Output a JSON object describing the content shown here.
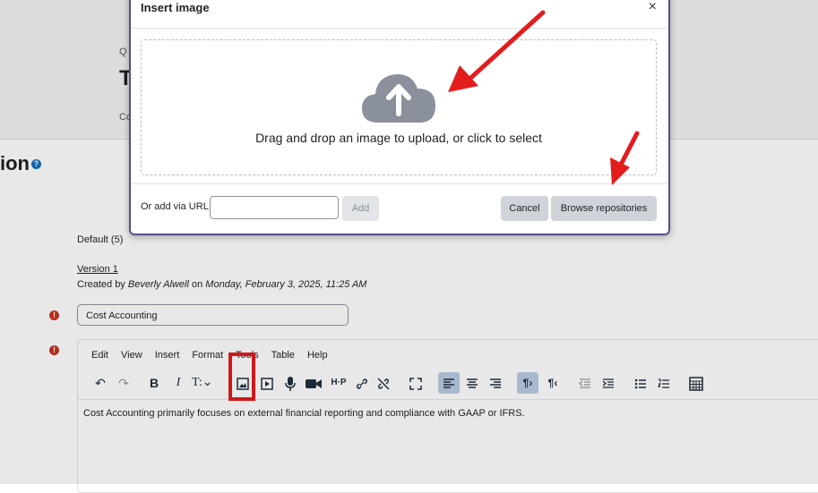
{
  "page": {
    "breadcrumb_fragment": "Q",
    "title_fragment": "T",
    "sub_fragment": "Co",
    "section_heading_fragment": "ion"
  },
  "question": {
    "default_text": "Default (5)",
    "version_label": "Version 1",
    "created_by_prefix": "Created by ",
    "created_by_name": "Beverly Alwell",
    "created_on_prefix": " on ",
    "created_on_date": "Monday, February 3, 2025, 11:25 AM",
    "name_value": "Cost Accounting"
  },
  "editor": {
    "menu": [
      "Edit",
      "View",
      "Insert",
      "Format",
      "Tools",
      "Table",
      "Help"
    ],
    "body_text": "Cost Accounting primarily focuses on external financial reporting and compliance with GAAP or IFRS.",
    "toolbar_icons": [
      "undo-icon",
      "redo-icon",
      "bold-icon",
      "italic-icon",
      "text-format-icon",
      "image-icon",
      "media-icon",
      "microphone-icon",
      "video-icon",
      "h5p-icon",
      "link-icon",
      "unlink-icon",
      "fullscreen-icon",
      "align-left-icon",
      "align-center-icon",
      "align-right-icon",
      "ltr-icon",
      "rtl-icon",
      "outdent-icon",
      "indent-icon",
      "bullet-list-icon",
      "numbered-list-icon",
      "calculator-icon"
    ]
  },
  "modal": {
    "title": "Insert image",
    "close_glyph": "×",
    "drop_text": "Drag and drop an image to upload, or click to select",
    "url_label": "Or add via URL",
    "add_label": "Add",
    "cancel_label": "Cancel",
    "browse_label": "Browse repositories"
  },
  "colors": {
    "annotation_red": "#e41c1c",
    "modal_border": "#5b4d8a",
    "cloud_grey": "#8a919c"
  }
}
